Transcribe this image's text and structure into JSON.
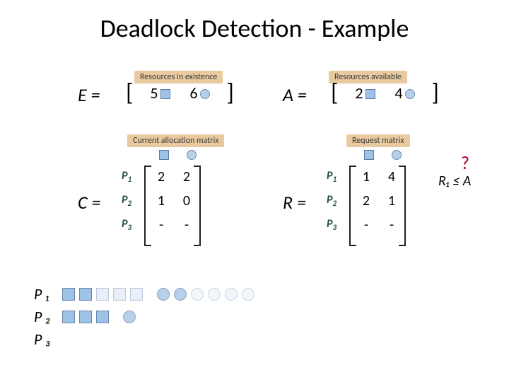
{
  "title": "Deadlock Detection - Example",
  "labels": {
    "resources_exist": "Resources in existence",
    "resources_avail": "Resources available",
    "alloc_matrix": "Current allocation matrix",
    "request_matrix": "Request matrix"
  },
  "E": {
    "name": "E =",
    "v1": "5",
    "v2": "6"
  },
  "A": {
    "name": "A =",
    "v1": "2",
    "v2": "4"
  },
  "C": {
    "name": "C =",
    "rows": [
      {
        "p": "P",
        "sub": "1",
        "c1": "2",
        "c2": "2"
      },
      {
        "p": "P",
        "sub": "2",
        "c1": "1",
        "c2": "0"
      },
      {
        "p": "P",
        "sub": "3",
        "c1": "-",
        "c2": "-"
      }
    ]
  },
  "R": {
    "name": "R =",
    "rows": [
      {
        "p": "P",
        "sub": "1",
        "c1": "1",
        "c2": "4"
      },
      {
        "p": "P",
        "sub": "2",
        "c1": "2",
        "c2": "1"
      },
      {
        "p": "P",
        "sub": "3",
        "c1": "-",
        "c2": "-"
      }
    ]
  },
  "question": "?",
  "check": "R₁ ≤ A",
  "procs": {
    "p1": "P ₁",
    "p2": "P ₂",
    "p3": "P ₃"
  },
  "chart_data": {
    "type": "table",
    "title": "Deadlock Detection - Example",
    "resource_types": [
      "square",
      "circle"
    ],
    "E": [
      5,
      6
    ],
    "A": [
      2,
      4
    ],
    "C": [
      [
        2,
        2
      ],
      [
        1,
        0
      ],
      [
        null,
        null
      ]
    ],
    "R": [
      [
        1,
        4
      ],
      [
        2,
        1
      ],
      [
        null,
        null
      ]
    ],
    "holdings": {
      "P1": {
        "squares_held": 2,
        "squares_total": 5,
        "circles_held": 2,
        "circles_total": 6
      },
      "P2": {
        "squares_held": 3,
        "squares_total": 3,
        "circles_held": 1,
        "circles_total": 1
      },
      "P3": {
        "squares_held": 0,
        "squares_total": 0,
        "circles_held": 0,
        "circles_total": 0
      }
    },
    "check": "R1 <= A"
  }
}
